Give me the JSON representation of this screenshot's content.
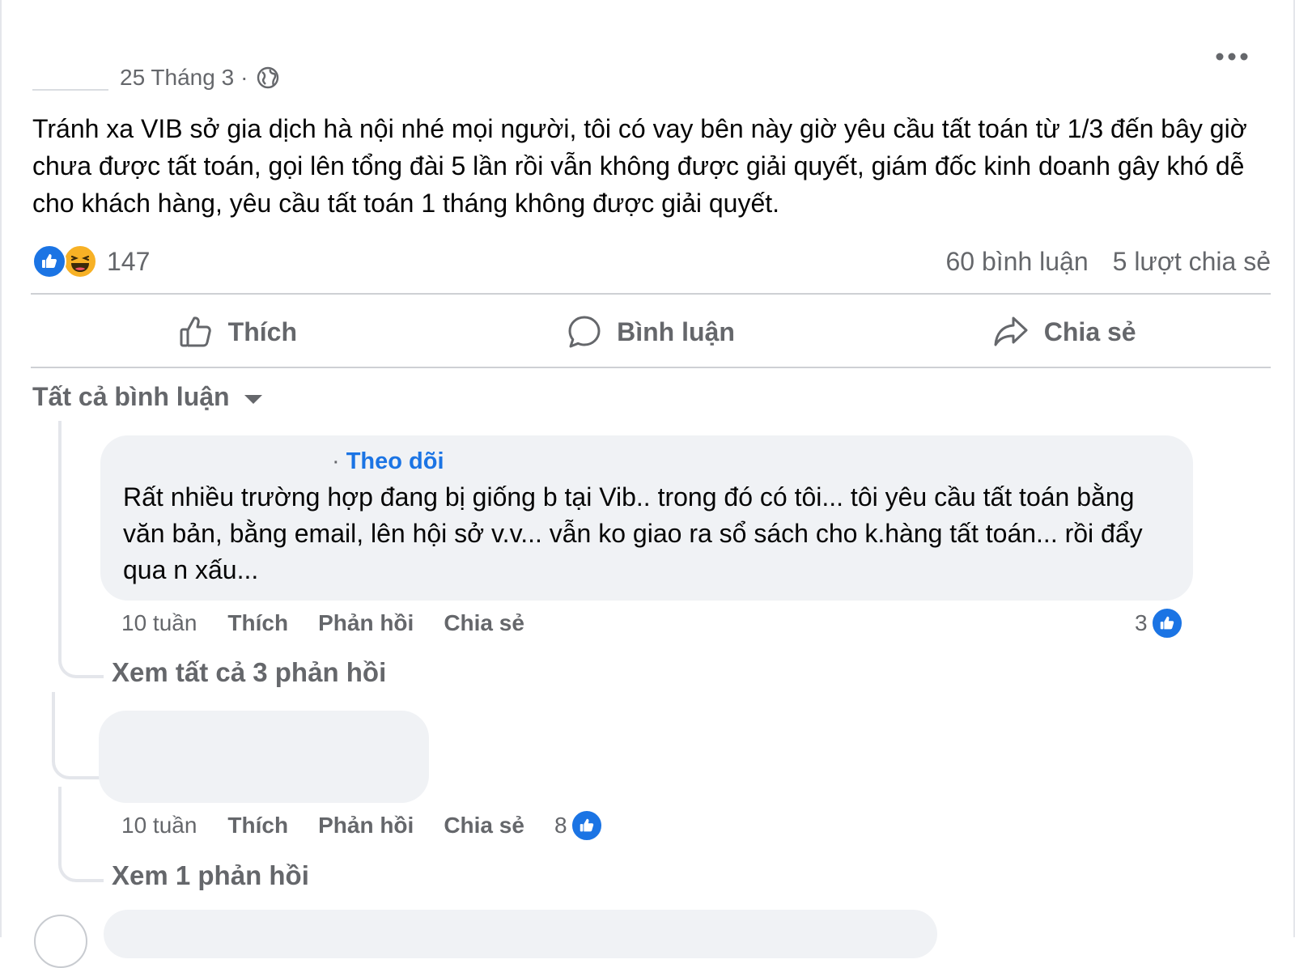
{
  "post": {
    "date": "25 Tháng 3",
    "separator": "·",
    "privacy_icon": "globe-icon",
    "text": "Tránh xa VIB sở gia dịch hà nội nhé mọi người, tôi có vay bên này giờ yêu cầu tất toán từ 1/3 đến bây giờ chưa được tất toán, gọi lên tổng đài 5 lần rồi vẫn không được giải quyết, giám đốc kinh doanh gây khó dễ cho khách hàng, yêu cầu tất toán 1 tháng không được giải quyết.",
    "reaction_count": "147",
    "reaction_icons": [
      "like-icon",
      "haha-icon"
    ],
    "comments_count": "60 bình luận",
    "shares_count": "5 lượt chia sẻ"
  },
  "actions": {
    "like": "Thích",
    "comment": "Bình luận",
    "share": "Chia sẻ"
  },
  "comments_sort": "Tất cả bình luận",
  "comments": [
    {
      "follow_label": "Theo dõi",
      "text": "Rất nhiều trường hợp đang bị giống b tại Vib.. trong đó có tôi... tôi yêu cầu tất toán bằng văn bản, bằng email, lên hội sở v.v... vẫn ko giao ra sổ sách cho k.hàng tất toán... rồi đẩy qua n xấu...",
      "time": "10 tuần",
      "like": "Thích",
      "reply": "Phản hồi",
      "share": "Chia sẻ",
      "likes": "3",
      "replies_link": "Xem tất cả 3 phản hồi"
    },
    {
      "time": "10 tuần",
      "like": "Thích",
      "reply": "Phản hồi",
      "share": "Chia sẻ",
      "likes": "8",
      "replies_link": "Xem 1 phản hồi"
    }
  ],
  "colors": {
    "accent": "#1b74e4",
    "secondary_text": "#65676b",
    "bubble": "#f0f2f5",
    "divider": "#ced0d4"
  }
}
